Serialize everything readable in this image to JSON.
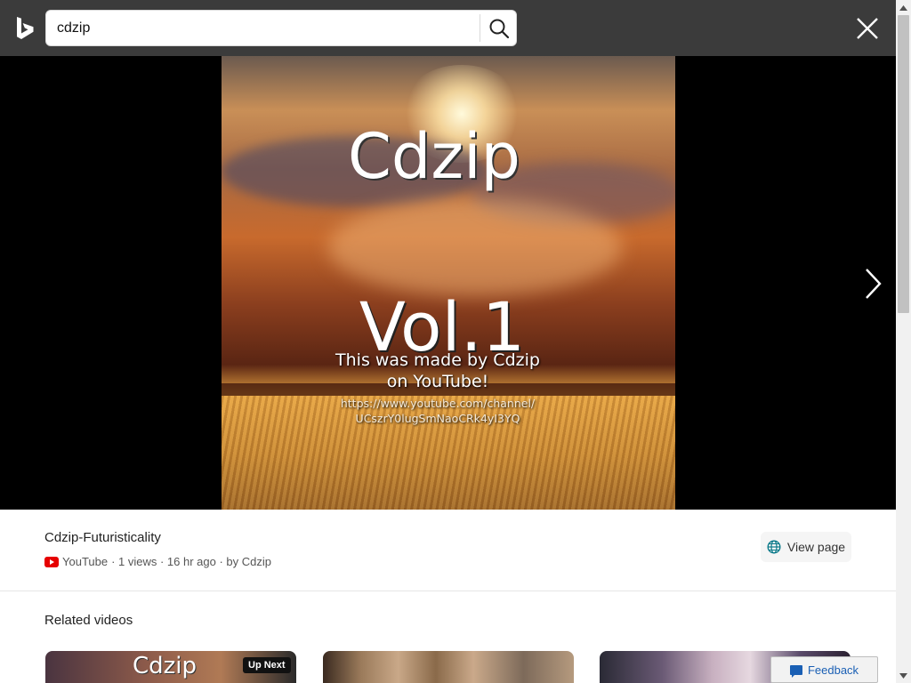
{
  "search": {
    "value": "cdzip",
    "search_icon": "search-icon"
  },
  "header": {
    "logo_icon": "bing-logo-icon",
    "close_icon": "close-icon"
  },
  "viewer": {
    "thumbnail": {
      "title_text": "Cdzip",
      "vol_text": "Vol.1",
      "made_line1": "This was made by Cdzip",
      "made_line2": "on YouTube!",
      "url_line1": "https://www.youtube.com/channel/",
      "url_line2": "UCszrY0lugSmNaoCRk4yI3YQ"
    },
    "next_icon": "chevron-right-icon"
  },
  "video": {
    "title": "Cdzip-Futuristicality",
    "source": "YouTube",
    "meta": "· 1 views · 16 hr ago · by Cdzip",
    "view_page_label": "View page"
  },
  "related": {
    "heading": "Related videos",
    "cards": [
      {
        "title": "Cdzip",
        "badge": "Up Next"
      },
      {
        "title": ""
      },
      {
        "title": ""
      }
    ]
  },
  "feedback": {
    "label": "Feedback"
  },
  "colors": {
    "topbar": "#3b3b3b",
    "viewer_bg": "#000000",
    "youtube_red": "#e60000",
    "feedback_blue": "#1a5fb4"
  }
}
